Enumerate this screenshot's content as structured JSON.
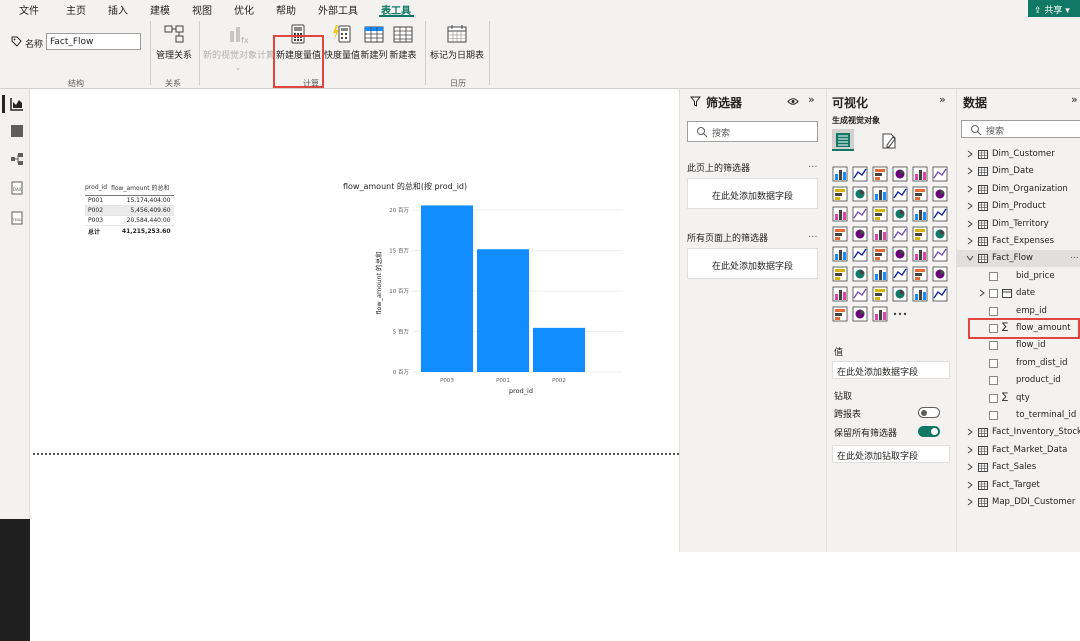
{
  "menu": {
    "items": [
      "文件",
      "主页",
      "插入",
      "建模",
      "视图",
      "优化",
      "帮助",
      "外部工具",
      "表工具"
    ],
    "active": "表工具",
    "share_label": "共享"
  },
  "ribbon": {
    "name_label": "名称",
    "name_value": "Fact_Flow",
    "structure_group": "结构",
    "manage_relations_label": "管理关系",
    "relations_group": "关系",
    "new_visual_calc_label": "新的视觉对象计算",
    "new_measure_label": "新建度量值",
    "quick_measure_label": "快度量值",
    "new_column_label": "新建列",
    "new_table_label": "新建表",
    "calc_group": "计算",
    "mark_date_table_label": "标记为日期表",
    "calendar_group": "日历"
  },
  "canvas": {
    "table": {
      "headers": [
        "prod_id",
        "flow_amount 的总和"
      ],
      "rows": [
        [
          "P001",
          "15,174,404.00"
        ],
        [
          "P002",
          "5,456,409.60"
        ],
        [
          "P003",
          "20,584,440.00"
        ]
      ],
      "total": [
        "总计",
        "41,215,253.60"
      ]
    }
  },
  "chart_data": {
    "type": "bar",
    "title": "flow_amount 的总和(按 prod_id)",
    "categories": [
      "P003",
      "P001",
      "P002"
    ],
    "values": [
      20584440.0,
      15174404.0,
      5456409.6
    ],
    "xlabel": "prod_id",
    "ylabel": "flow_amount 的总和",
    "ylim": [
      0,
      22000000
    ],
    "yticks": [
      0,
      5000000,
      10000000,
      15000000,
      20000000
    ],
    "ytick_labels": [
      "0 百万",
      "5 百万",
      "10 百万",
      "15 百万",
      "20 百万"
    ],
    "bar_color": "#118dff",
    "grid": true
  },
  "filters": {
    "title": "筛选器",
    "search_placeholder": "搜索",
    "this_page_label": "此页上的筛选器",
    "this_page_well": "在此处添加数据字段",
    "all_pages_label": "所有页面上的筛选器",
    "all_pages_well": "在此处添加数据字段",
    "more": "..."
  },
  "viz": {
    "title": "可视化",
    "build_label": "生成视觉对象",
    "values_label": "值",
    "values_well": "在此处添加数据字段",
    "drill_label": "钻取",
    "cross_report_label": "跨报表",
    "cross_report_on": false,
    "keep_filters_label": "保留所有筛选器",
    "keep_filters_on": true,
    "drill_well": "在此处添加钻取字段",
    "more": "..."
  },
  "data": {
    "title": "数据",
    "search_placeholder": "搜索",
    "tables_top": [
      "Dim_Customer",
      "Dim_Date",
      "Dim_Organization",
      "Dim_Product",
      "Dim_Territory",
      "Fact_Expenses"
    ],
    "selected_table": "Fact_Flow",
    "fields": [
      {
        "name": "bid_price",
        "sigma": false,
        "expand": false,
        "icon": false
      },
      {
        "name": "date",
        "sigma": false,
        "expand": true,
        "icon": true
      },
      {
        "name": "emp_id",
        "sigma": false,
        "expand": false,
        "icon": false
      },
      {
        "name": "flow_amount",
        "sigma": true,
        "expand": false,
        "icon": false
      },
      {
        "name": "flow_id",
        "sigma": false,
        "expand": false,
        "icon": false
      },
      {
        "name": "from_dist_id",
        "sigma": false,
        "expand": false,
        "icon": false
      },
      {
        "name": "product_id",
        "sigma": false,
        "expand": false,
        "icon": false
      },
      {
        "name": "qty",
        "sigma": true,
        "expand": false,
        "icon": false
      },
      {
        "name": "to_terminal_id",
        "sigma": false,
        "expand": false,
        "icon": false
      }
    ],
    "tables_bottom": [
      "Fact_Inventory_Stock",
      "Fact_Market_Data",
      "Fact_Sales",
      "Fact_Target",
      "Map_DDI_Customer"
    ],
    "more": "..."
  }
}
